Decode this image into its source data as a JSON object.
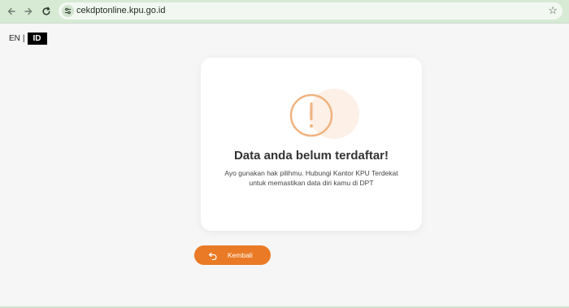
{
  "browser": {
    "url": "cekdptonline.kpu.go.id"
  },
  "language": {
    "options": [
      "EN",
      "ID"
    ],
    "separator": "|",
    "active": "ID"
  },
  "result": {
    "title": "Data anda belum terdaftar!",
    "description_line1": "Ayo gunakan hak pilihmu. Hubungi Kantor KPU Terdekat",
    "description_line2": "untuk memastikan data diri kamu di DPT"
  },
  "back_button": {
    "label": "Kembali"
  },
  "colors": {
    "accent": "#ea7a25",
    "warning_icon": "#f0b37f",
    "warning_bg": "#fdf0e7"
  }
}
